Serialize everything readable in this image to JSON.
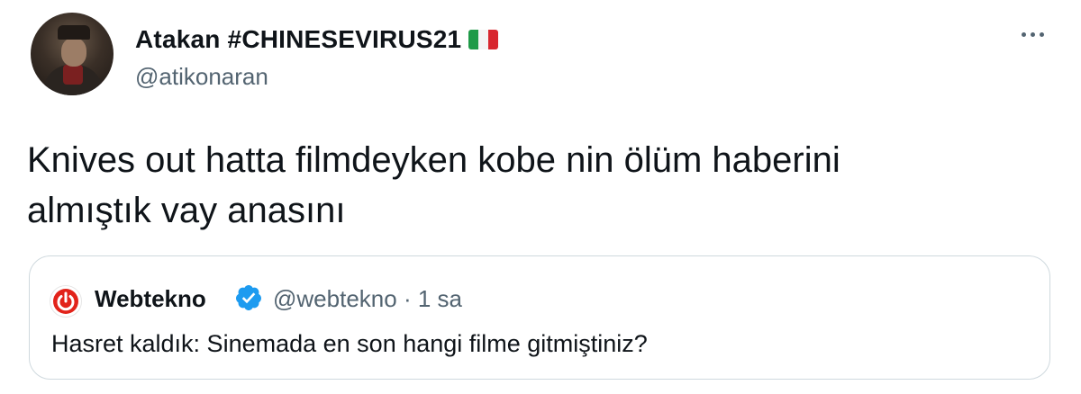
{
  "author": {
    "display_name": "Atakan #CHINESEVIRUS21",
    "handle": "@atikonaran",
    "flag_icon": "italy-flag-icon"
  },
  "tweet": {
    "text_line1": "Knives out hatta filmdeyken kobe nin ölüm haberini",
    "text_line2": "almıştık vay anasını"
  },
  "quoted_tweet": {
    "display_name": "Webtekno",
    "handle": "@webtekno",
    "separator": "·",
    "time": "1 sa",
    "text": "Hasret kaldık: Sinemada en son hangi filme gitmiştiniz?",
    "verified_icon": "verified-badge-icon"
  },
  "colors": {
    "text": "#0f1419",
    "secondary": "#536471",
    "border": "#cfd9de",
    "verified": "#1d9bf0",
    "webtekno_red": "#e2231a"
  }
}
